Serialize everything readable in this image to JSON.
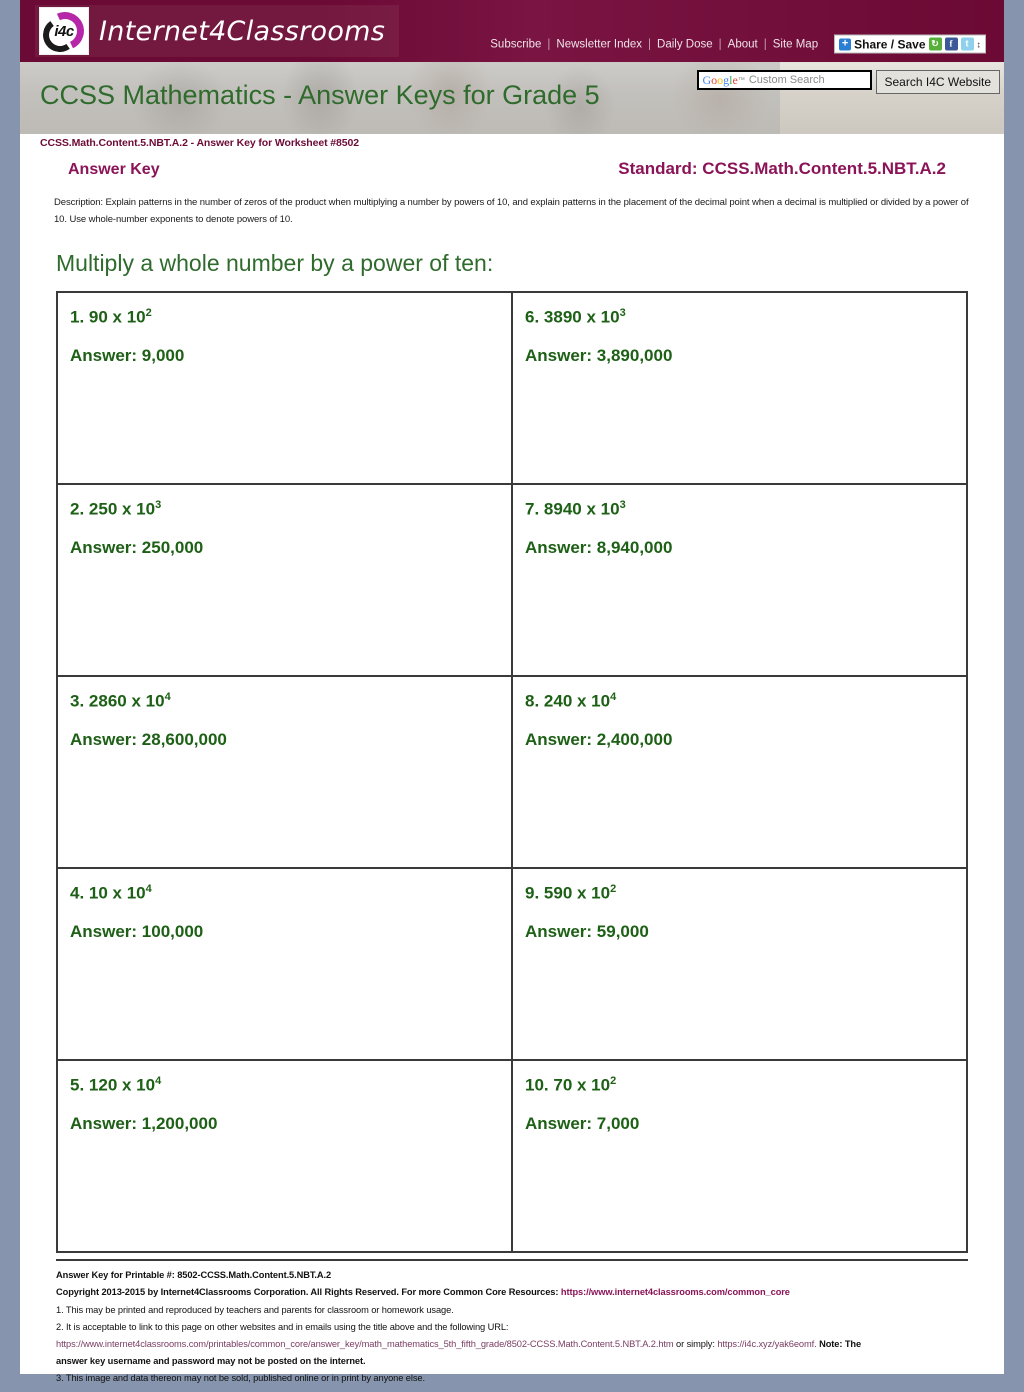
{
  "site": {
    "brand_name": "Internet4Classrooms",
    "logo_text": "i4c"
  },
  "topnav": {
    "items": [
      {
        "label": "Subscribe"
      },
      {
        "label": "Newsletter Index"
      },
      {
        "label": "Daily Dose"
      },
      {
        "label": "About"
      },
      {
        "label": "Site Map"
      }
    ],
    "separator": "|",
    "share": {
      "label": "Share / Save",
      "plus_glyph": "+",
      "icons": [
        "share-green-icon",
        "facebook-icon",
        "twitter-icon",
        "updown-caret-icon"
      ],
      "caret": "↕"
    }
  },
  "search": {
    "google_brand": "Google",
    "trademark": "™",
    "placeholder": "Custom Search",
    "value": "",
    "button_label": "Search I4C Website"
  },
  "banner": {
    "title": "CCSS Mathematics - Answer Keys for Grade 5",
    "subid": "CCSS.Math.Content.5.NBT.A.2 - Answer Key for Worksheet #8502"
  },
  "header": {
    "answer_key_label": "Answer Key",
    "standard_label": "Standard: CCSS.Math.Content.5.NBT.A.2"
  },
  "description": "Description: Explain patterns in the number of zeros of the product when multiplying a number by powers of 10, and explain patterns in the placement of the decimal point when a decimal is multiplied or divided by a power of 10. Use whole-number exponents to denote powers of 10.",
  "section_title": "Multiply a whole number by a power of ten:",
  "problems": [
    {
      "num": "1.",
      "base": "90 x 10",
      "exp": "2",
      "answer": "Answer: 9,000"
    },
    {
      "num": "6.",
      "base": "3890 x 10",
      "exp": "3",
      "answer": "Answer: 3,890,000"
    },
    {
      "num": "2.",
      "base": "250 x 10",
      "exp": "3",
      "answer": "Answer: 250,000"
    },
    {
      "num": "7.",
      "base": "8940 x 10",
      "exp": "3",
      "answer": "Answer: 8,940,000"
    },
    {
      "num": "3.",
      "base": "2860 x 10",
      "exp": "4",
      "answer": "Answer: 28,600,000"
    },
    {
      "num": "8.",
      "base": "240 x 10",
      "exp": "4",
      "answer": "Answer: 2,400,000"
    },
    {
      "num": "4.",
      "base": "10 x 10",
      "exp": "4",
      "answer": "Answer: 100,000"
    },
    {
      "num": "9.",
      "base": "590 x 10",
      "exp": "2",
      "answer": "Answer: 59,000"
    },
    {
      "num": "5.",
      "base": "120 x 10",
      "exp": "4",
      "answer": "Answer: 1,200,000"
    },
    {
      "num": "10.",
      "base": "70 x 10",
      "exp": "2",
      "answer": " Answer: 7,000"
    }
  ],
  "footer": {
    "printable_line": "Answer Key for Printable #: 8502-CCSS.Math.Content.5.NBT.A.2",
    "copyright_prefix": "Copyright 2013-2015 by Internet4Classrooms Corporation. All Rights Reserved. For more Common Core Resources:",
    "copyright_link": "https://www.internet4classrooms.com/common_core",
    "line1": "1. This may be printed and reproduced by teachers and parents for classroom or homework usage.",
    "line2": "2. It is acceptable to link to this page on other websites and in emails using the title above and the following URL:",
    "line2_url": "https://www.internet4classrooms.com/printables/common_core/answer_key/math_mathematics_5th_fifth_grade/8502-CCSS.Math.Content.5.NBT.A.2.htm",
    "line2_mid": "or simply:",
    "line2_short_url": "https://i4c.xyz/yak6eomf.",
    "line2_note": "Note: The",
    "line2_cont": "answer key username and password may not be posted on the internet.",
    "line3": "3. This image and data thereon may not be sold, published online or in print by anyone else."
  },
  "colors": {
    "page_background": "#8695ad",
    "brand_maroon": "#6d0b36",
    "heading_green": "#2f6b2c",
    "problem_green": "#1d6016",
    "standard_magenta": "#8b1458"
  }
}
